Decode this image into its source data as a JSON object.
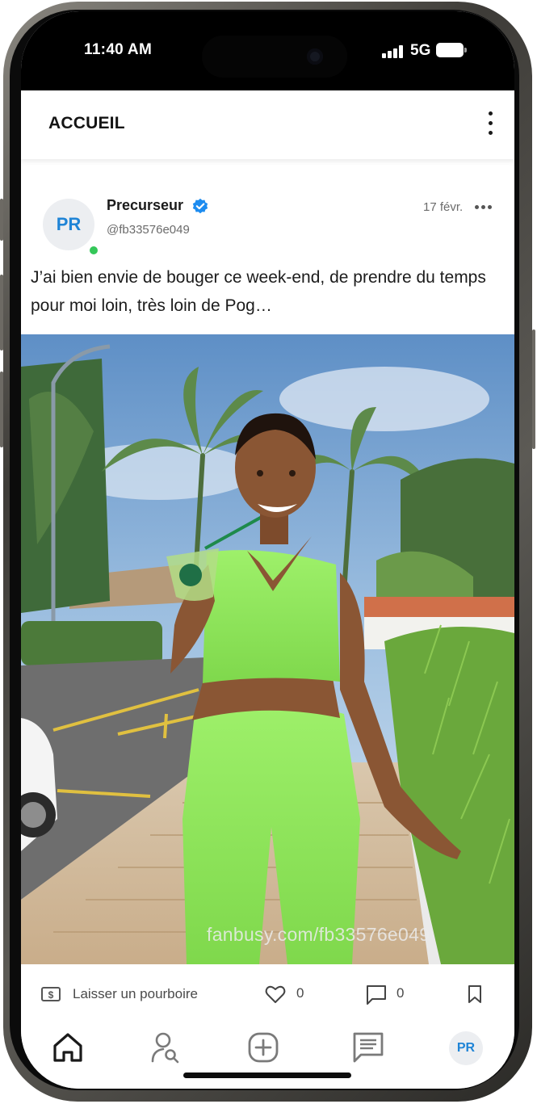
{
  "status_bar": {
    "time": "11:40 AM",
    "network": "5G"
  },
  "header": {
    "title": "ACCUEIL",
    "menu_icon": "kebab-vertical-icon"
  },
  "post": {
    "avatar_initials": "PR",
    "author": "Precurseur",
    "verified": true,
    "handle": "@fb33576e049",
    "date": "17 févr.",
    "text": "J’ai bien envie de bouger ce week-end, de prendre du temps pour moi loin, très loin de Pog…",
    "watermark": "fanbusy.com/fb33576e049",
    "tip_label": "Laisser un pourboire",
    "likes": "0",
    "comments": "0"
  },
  "bottom_nav": {
    "items": [
      "home-icon",
      "search-user-icon",
      "add-post-icon",
      "messages-icon"
    ],
    "profile_initials": "PR"
  },
  "colors": {
    "accent": "#1f84d6",
    "verified": "#1d8cf0",
    "online": "#34c759"
  }
}
